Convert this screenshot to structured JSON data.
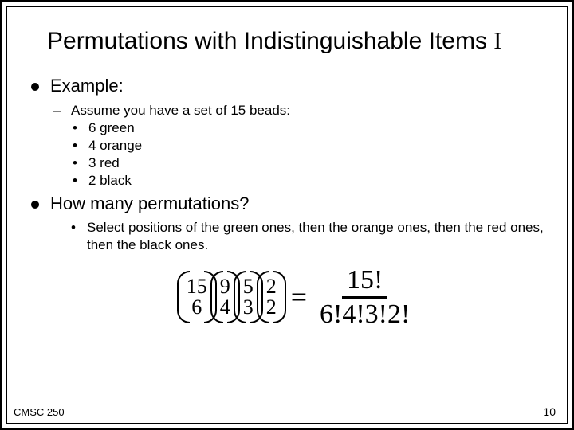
{
  "title_main": "Permutations with Indistinguishable Items ",
  "title_roman": "I",
  "bullet1": "Example:",
  "dash1": "Assume you have a set of 15 beads:",
  "beads": {
    "a": "6 green",
    "b": "4 orange",
    "c": "3 red",
    "d": "2 black"
  },
  "bullet2": "How many permutations?",
  "step": "Select positions of the green ones, then the orange ones, then the red ones, then the black ones.",
  "binoms": {
    "b1t": "15",
    "b1b": "6",
    "b2t": "9",
    "b2b": "4",
    "b3t": "5",
    "b3b": "3",
    "b4t": "2",
    "b4b": "2"
  },
  "eq": "=",
  "frac_top": "15!",
  "frac_bot": "6!4!3!2!",
  "footer_left": "CMSC 250",
  "footer_right": "10"
}
